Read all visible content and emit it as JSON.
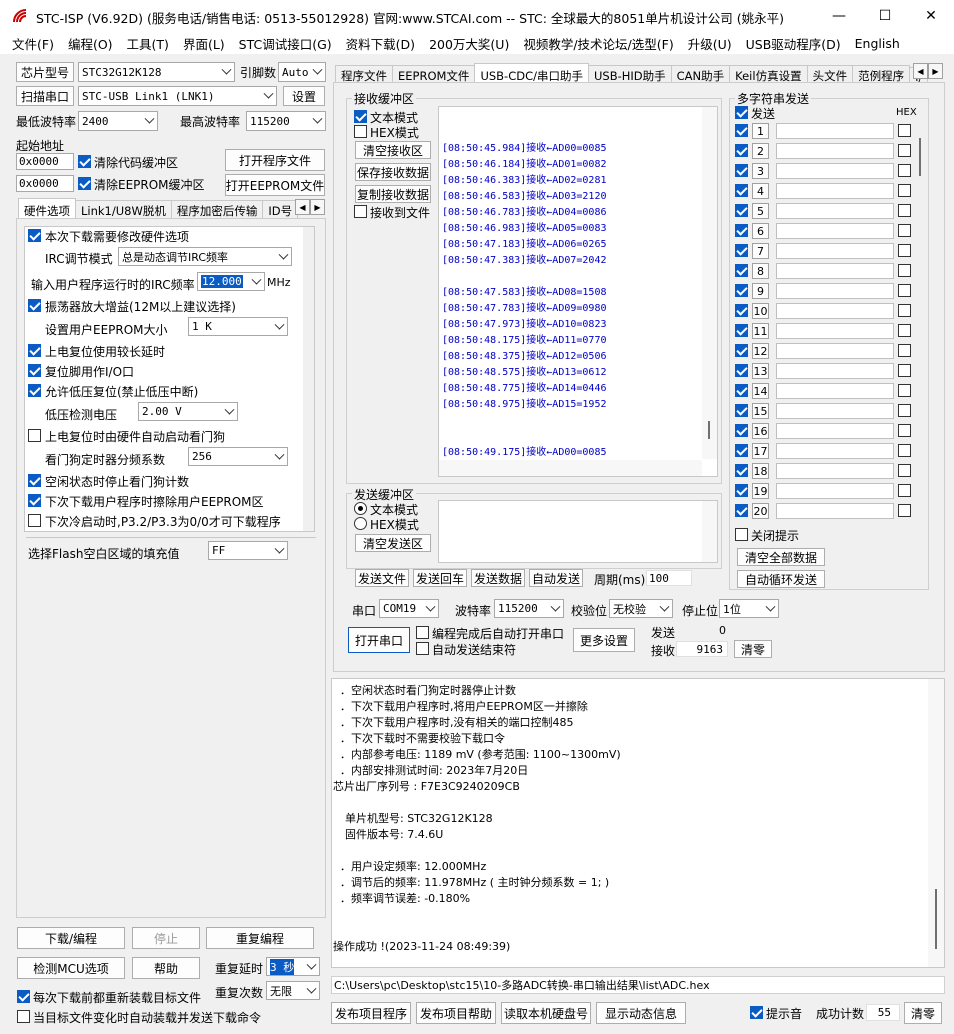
{
  "window": {
    "title": "STC-ISP (V6.92D) (服务电话/销售电话: 0513-55012928) 官网:www.STCAI.com  -- STC: 全球最大的8051单片机设计公司 (姚永平)"
  },
  "menu": [
    "文件(F)",
    "编程(O)",
    "工具(T)",
    "界面(L)",
    "STC调试接口(G)",
    "资料下载(D)",
    "200万大奖(U)",
    "视频教学/技术论坛/选型(F)",
    "升级(U)",
    "USB驱动程序(D)",
    "English"
  ],
  "left": {
    "chip_label": "芯片型号",
    "chip_value": "STC32G12K128",
    "pin_label": "引脚数",
    "pin_value": "Auto",
    "scan_label": "扫描串口",
    "port_value": "STC-USB Link1 (LNK1)",
    "settings_label": "设置",
    "minbaud_label": "最低波特率",
    "minbaud_value": "2400",
    "maxbaud_label": "最高波特率",
    "maxbaud_value": "115200",
    "start_addr_label": "起始地址",
    "addr1": "0x0000",
    "clear_code": "清除代码缓冲区",
    "open_prog": "打开程序文件",
    "addr2": "0x0000",
    "clear_eeprom": "清除EEPROM缓冲区",
    "open_eeprom": "打开EEPROM文件",
    "tabs": [
      "硬件选项",
      "Link1/U8W脱机",
      "程序加密后传输",
      "ID号"
    ],
    "options": {
      "o1": "本次下载需要修改硬件选项",
      "irc_mode_label": "IRC调节模式",
      "irc_mode_value": "总是动态调节IRC频率",
      "freq_label": "输入用户程序运行时的IRC频率",
      "freq_value": "12.000",
      "freq_unit": "MHz",
      "o2": "振荡器放大增益(12M以上建议选择)",
      "eeprom_label": "设置用户EEPROM大小",
      "eeprom_value": "1   K",
      "o3": "上电复位使用较长延时",
      "o4": "复位脚用作I/O口",
      "o5": "允许低压复位(禁止低压中断)",
      "lv_label": "低压检测电压",
      "lv_value": "2.00 V",
      "o6": "上电复位时由硬件自动启动看门狗",
      "wdt_label": "看门狗定时器分频系数",
      "wdt_value": "256",
      "o7": "空闲状态时停止看门狗计数",
      "o8": "下次下载用户程序时擦除用户EEPROM区",
      "o9": "下次冷启动时,P3.2/P3.3为0/0才可下载程序",
      "fill_label": "选择Flash空白区域的填充值",
      "fill_value": "FF"
    },
    "btn_download": "下载/编程",
    "btn_stop": "停止",
    "btn_reprog": "重复编程",
    "btn_check": "检测MCU选项",
    "btn_help": "帮助",
    "delay_label": "重复延时",
    "delay_value": "3 秒",
    "reload_each": "每次下载前都重新装载目标文件",
    "repeat_label": "重复次数",
    "repeat_value": "无限",
    "auto_load": "当目标文件变化时自动装载并发送下载命令"
  },
  "right": {
    "tabs": [
      "程序文件",
      "EEPROM文件",
      "USB-CDC/串口助手",
      "USB-HID助手",
      "CAN助手",
      "Keil仿真设置",
      "头文件",
      "范例程序",
      "I/"
    ],
    "recv": {
      "title": "接收缓冲区",
      "text_mode": "文本模式",
      "hex_mode": "HEX模式",
      "clear": "清空接收区",
      "save": "保存接收数据",
      "copy": "复制接收数据",
      "to_file": "接收到文件",
      "lines": [
        "[08:50:45.984]接收←AD00=0085",
        "[08:50:46.184]接收←AD01=0082",
        "[08:50:46.383]接收←AD02=0281",
        "[08:50:46.583]接收←AD03=2120",
        "[08:50:46.783]接收←AD04=0086",
        "[08:50:46.983]接收←AD05=0083",
        "[08:50:47.183]接收←AD06=0265",
        "[08:50:47.383]接收←AD07=2042",
        "[08:50:47.583]接收←AD08=1508",
        "[08:50:47.783]接收←AD09=0980",
        "[08:50:47.973]接收←AD10=0823",
        "[08:50:48.175]接收←AD11=0770",
        "[08:50:48.375]接收←AD12=0506",
        "[08:50:48.575]接收←AD13=0612",
        "[08:50:48.775]接收←AD14=0446",
        "[08:50:48.975]接收←AD15=1952",
        "[08:50:49.175]接收←AD00=0085"
      ]
    },
    "send": {
      "title": "发送缓冲区",
      "text_mode": "文本模式",
      "hex_mode": "HEX模式",
      "clear": "清空发送区",
      "btn_file": "发送文件",
      "btn_return": "发送回车",
      "btn_data": "发送数据",
      "btn_auto": "自动发送",
      "period_label": "周期(ms)",
      "period_value": "100"
    },
    "port": {
      "port_label": "串口",
      "port_value": "COM19",
      "baud_label": "波特率",
      "baud_value": "115200",
      "parity_label": "校验位",
      "parity_value": "无校验",
      "stop_label": "停止位",
      "stop_value": "1位",
      "open": "打开串口",
      "auto_open": "编程完成后自动打开串口",
      "auto_end": "自动发送结束符",
      "more": "更多设置",
      "send_label": "发送",
      "send_count": "0",
      "recv_label": "接收",
      "recv_count": "9163",
      "clear": "清零"
    },
    "multi": {
      "title": "多字符串发送",
      "send": "发送",
      "hex": "HEX",
      "rows": [
        "1",
        "2",
        "3",
        "4",
        "5",
        "6",
        "7",
        "8",
        "9",
        "10",
        "11",
        "12",
        "13",
        "14",
        "15",
        "16",
        "17",
        "18",
        "19",
        "20"
      ],
      "close_hint": "关闭提示",
      "clear_all": "清空全部数据",
      "auto_loop": "自动循环发送"
    }
  },
  "log": {
    "lines": [
      "．空闲状态时看门狗定时器停止计数",
      "．下次下载用户程序时,将用户EEPROM区一并擦除",
      "．下次下载用户程序时,没有相关的端口控制485",
      "．下次下载时不需要校验下载口令",
      "．内部参考电压: 1189 mV (参考范围: 1100~1300mV)",
      "．内部安排测试时间: 2023年7月20日",
      "芯片出厂序列号 : F7E3C9240209CB",
      "单片机型号: STC32G12K128",
      "固件版本号: 7.4.6U",
      "．用户设定频率: 12.000MHz",
      "．调节后的频率: 11.978MHz ( 主时钟分频系数 = 1; )",
      "．频率调节误差: -0.180%",
      "操作成功 !(2023-11-24 08:49:39)"
    ]
  },
  "path": "C:\\Users\\pc\\Desktop\\stc15\\10-多路ADC转换-串口输出结果\\list\\ADC.hex",
  "bottom": {
    "publish": "发布项目程序",
    "publish_help": "发布项目帮助",
    "read_disk": "读取本机硬盘号",
    "show_dyn": "显示动态信息",
    "beep": "提示音",
    "success_label": "成功计数",
    "success_value": "55",
    "clear": "清零"
  }
}
